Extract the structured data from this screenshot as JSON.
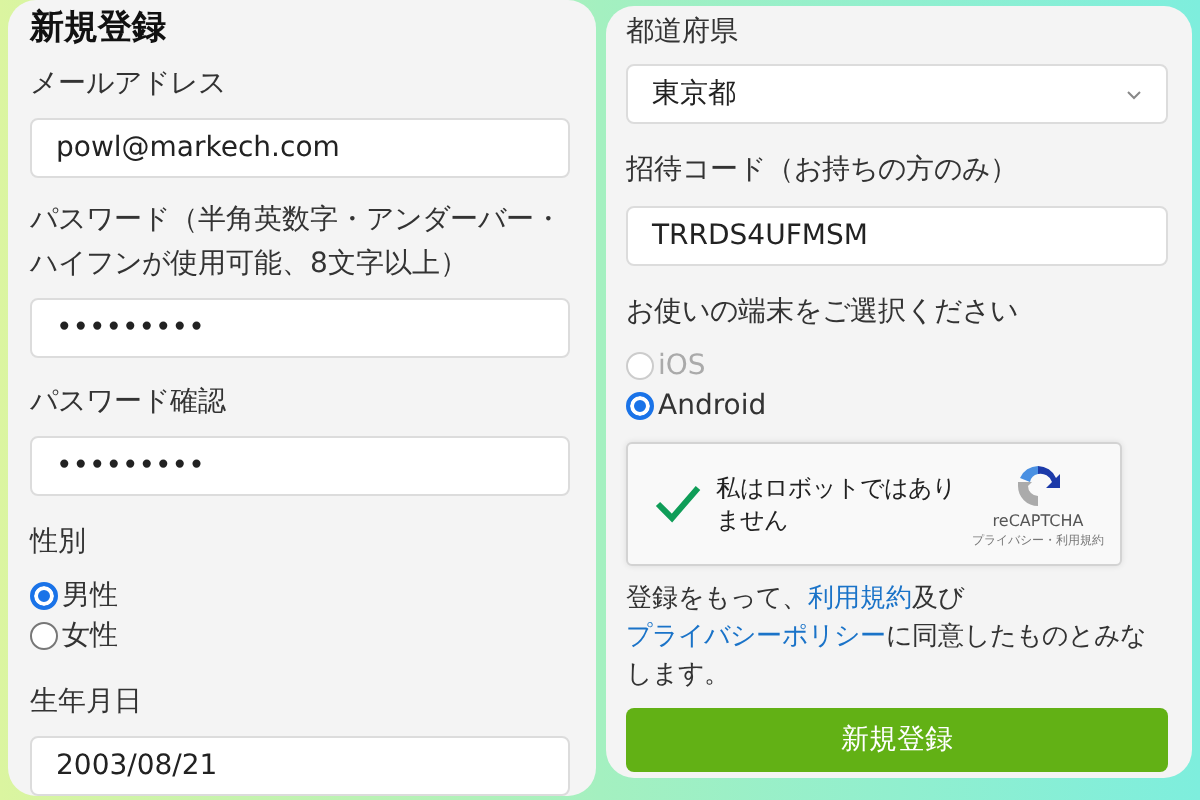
{
  "left_panel": {
    "title": "新規登録",
    "email": {
      "label": "メールアドレス",
      "value": "powl@markech.com"
    },
    "password": {
      "label": "パスワード（半角英数字・アンダーバー・ハイフンが使用可能、8文字以上）",
      "value": "•••••••••"
    },
    "password_confirm": {
      "label": "パスワード確認",
      "value": "•••••••••"
    },
    "gender": {
      "label": "性別",
      "options": [
        {
          "label": "男性",
          "selected": true,
          "disabled": false
        },
        {
          "label": "女性",
          "selected": false,
          "disabled": false
        }
      ]
    },
    "birthdate": {
      "label": "生年月日",
      "value": "2003/08/21"
    }
  },
  "right_panel": {
    "prefecture": {
      "label": "都道府県",
      "value": "東京都"
    },
    "invite_code": {
      "label": "招待コード（お持ちの方のみ）",
      "value": "TRRDS4UFMSM"
    },
    "device": {
      "label": "お使いの端末をご選択ください",
      "options": [
        {
          "label": "iOS",
          "selected": false,
          "disabled": true
        },
        {
          "label": "Android",
          "selected": true,
          "disabled": false
        }
      ]
    },
    "captcha": {
      "checked": true,
      "text": "私はロボットではありません",
      "brand": "reCAPTCHA",
      "links": "プライバシー・利用規約"
    },
    "consent": [
      {
        "kind": "text",
        "text": "登録をもって、"
      },
      {
        "kind": "link",
        "text": "利用規約"
      },
      {
        "kind": "text",
        "text": "及び"
      },
      {
        "kind": "link",
        "text": "プライバシーポリシー"
      },
      {
        "kind": "text",
        "text": "に同意したものとみなします。"
      }
    ],
    "submit": "新規登録"
  }
}
